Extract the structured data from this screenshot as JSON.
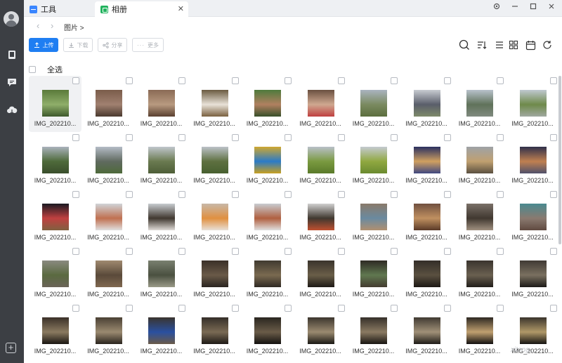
{
  "tabs": [
    {
      "label": "工具"
    },
    {
      "label": "相册"
    }
  ],
  "window": {
    "close_tab_glyph": "✕"
  },
  "breadcrumb": {
    "path": "图片 >"
  },
  "toolbar": {
    "upload": "上传",
    "download": "下载",
    "share": "分享",
    "more": "更多"
  },
  "select_all": "全选",
  "watermark": "xitong... ",
  "colors": {
    "accent": "#1f7ef2",
    "sidebar": "#3c3f44",
    "album_tab_icon": "#22b35e",
    "tools_tab_icon": "#3a86ff"
  },
  "icons": [
    "user-avatar-icon",
    "phone-icon",
    "chat-icon",
    "cloud-icon",
    "add-icon",
    "search-icon",
    "sort-icon",
    "list-view-icon",
    "grid-view-icon",
    "calendar-icon",
    "refresh-icon"
  ],
  "photos": [
    {
      "name": "IMG_202210...",
      "c": [
        "#5a7a3a",
        "#8fae6a",
        "#3e5a2c"
      ]
    },
    {
      "name": "IMG_202210...",
      "c": [
        "#7a5c4a",
        "#a08070",
        "#4b3a2f"
      ]
    },
    {
      "name": "IMG_202210...",
      "c": [
        "#8a6a55",
        "#b89a80",
        "#5a4030"
      ]
    },
    {
      "name": "IMG_202210...",
      "c": [
        "#6a5a40",
        "#e8e2d8",
        "#7a6040"
      ]
    },
    {
      "name": "IMG_202210...",
      "c": [
        "#4e7a3c",
        "#b08060",
        "#38502a"
      ]
    },
    {
      "name": "IMG_202210...",
      "c": [
        "#6a5040",
        "#cfa890",
        "#c04040"
      ]
    },
    {
      "name": "IMG_202210...",
      "c": [
        "#aab4c0",
        "#7a8a60",
        "#5c6e3e"
      ]
    },
    {
      "name": "IMG_202210...",
      "c": [
        "#c8ccd2",
        "#5a5e6a",
        "#7e8a6a"
      ]
    },
    {
      "name": "IMG_202210...",
      "c": [
        "#b8c2cc",
        "#60725a",
        "#808a80"
      ]
    },
    {
      "name": "IMG_202210...",
      "c": [
        "#c0c8d0",
        "#6e8a4a",
        "#a0a8a0"
      ]
    },
    {
      "name": "IMG_202210...",
      "c": [
        "#aab2bc",
        "#4e6a3a",
        "#3a4e2c"
      ]
    },
    {
      "name": "IMG_202210...",
      "c": [
        "#b4bcc6",
        "#606a60",
        "#4e6a3a"
      ]
    },
    {
      "name": "IMG_202210...",
      "c": [
        "#c0c6cc",
        "#6a7a50",
        "#4e5e38"
      ]
    },
    {
      "name": "IMG_202210...",
      "c": [
        "#bcc2c8",
        "#5e7040",
        "#486030"
      ]
    },
    {
      "name": "IMG_202210...",
      "c": [
        "#d0a830",
        "#2a7ac8",
        "#c8a020"
      ]
    },
    {
      "name": "IMG_202210...",
      "c": [
        "#b8c0c8",
        "#7a9a40",
        "#5a7a2a"
      ]
    },
    {
      "name": "IMG_202210...",
      "c": [
        "#c4cad0",
        "#90a840",
        "#6a8a30"
      ]
    },
    {
      "name": "IMG_202210...",
      "c": [
        "#2a3060",
        "#d0a060",
        "#404880"
      ]
    },
    {
      "name": "IMG_202210...",
      "c": [
        "#9ea2a6",
        "#c0a070",
        "#5a5040"
      ]
    },
    {
      "name": "IMG_202210...",
      "c": [
        "#30304a",
        "#c08050",
        "#50506a"
      ]
    },
    {
      "name": "IMG_202210...",
      "c": [
        "#1a1a22",
        "#c04040",
        "#806040"
      ]
    },
    {
      "name": "IMG_202210...",
      "c": [
        "#d0d4d8",
        "#c07050",
        "#e0e0e0"
      ]
    },
    {
      "name": "IMG_202210...",
      "c": [
        "#c8ccd0",
        "#403830",
        "#e0dcd8"
      ]
    },
    {
      "name": "IMG_202210...",
      "c": [
        "#c8b8a8",
        "#e09040",
        "#e8e0d8"
      ]
    },
    {
      "name": "IMG_202210...",
      "c": [
        "#c8ccd0",
        "#b06040",
        "#e0e0e0"
      ]
    },
    {
      "name": "IMG_202210...",
      "c": [
        "#d0d0d0",
        "#403830",
        "#c05030"
      ]
    },
    {
      "name": "IMG_202210...",
      "c": [
        "#8a7a6a",
        "#6a8aa0",
        "#b09070"
      ]
    },
    {
      "name": "IMG_202210...",
      "c": [
        "#705040",
        "#c09060",
        "#5a3a28"
      ]
    },
    {
      "name": "IMG_202210...",
      "c": [
        "#7a7068",
        "#403830",
        "#a09080"
      ]
    },
    {
      "name": "IMG_202210...",
      "c": [
        "#4a8a90",
        "#8a7a70",
        "#604a40"
      ]
    },
    {
      "name": "IMG_202210...",
      "c": [
        "#8a8a80",
        "#5a6a40",
        "#6a6458"
      ]
    },
    {
      "name": "IMG_202210...",
      "c": [
        "#a08a70",
        "#5a4a3a",
        "#806850"
      ]
    },
    {
      "name": "IMG_202210...",
      "c": [
        "#7a8070",
        "#4a5040",
        "#9a9a88"
      ]
    },
    {
      "name": "IMG_202210...",
      "c": [
        "#3a3028",
        "#6a5a48",
        "#2a2420"
      ]
    },
    {
      "name": "IMG_202210...",
      "c": [
        "#403a30",
        "#7a6a50",
        "#302a24"
      ]
    },
    {
      "name": "IMG_202210...",
      "c": [
        "#3a342c",
        "#6a5e48",
        "#1e1a16"
      ]
    },
    {
      "name": "IMG_202210...",
      "c": [
        "#2e2a24",
        "#607850",
        "#443c30"
      ]
    },
    {
      "name": "IMG_202210...",
      "c": [
        "#342e28",
        "#5a5040",
        "#1c1814"
      ]
    },
    {
      "name": "IMG_202210...",
      "c": [
        "#3a342e",
        "#6a6050",
        "#221e1a"
      ]
    },
    {
      "name": "IMG_202210...",
      "c": [
        "#403a34",
        "#7a7060",
        "#1c1a18"
      ]
    },
    {
      "name": "IMG_202210...",
      "c": [
        "#3a3028",
        "#8a7a60",
        "#1a1612"
      ]
    },
    {
      "name": "IMG_202210...",
      "c": [
        "#4a4034",
        "#9a8a70",
        "#2a241e"
      ]
    },
    {
      "name": "IMG_202210...",
      "c": [
        "#3a342e",
        "#2a50a0",
        "#6a5a48"
      ]
    },
    {
      "name": "IMG_202210...",
      "c": [
        "#342e28",
        "#7a6a54",
        "#1e1a16"
      ]
    },
    {
      "name": "IMG_202210...",
      "c": [
        "#2a2620",
        "#6a5c48",
        "#141210"
      ]
    },
    {
      "name": "IMG_202210...",
      "c": [
        "#3c362e",
        "#9a8a70",
        "#1a1814"
      ]
    },
    {
      "name": "IMG_202210...",
      "c": [
        "#36302a",
        "#8a7a62",
        "#181512"
      ]
    },
    {
      "name": "IMG_202210...",
      "c": [
        "#403a32",
        "#a09078",
        "#1e1b17"
      ]
    },
    {
      "name": "IMG_202210...",
      "c": [
        "#2e2822",
        "#c0a070",
        "#121010"
      ]
    },
    {
      "name": "IMG_202210...",
      "c": [
        "#3a342c",
        "#b09868",
        "#161412"
      ]
    }
  ]
}
